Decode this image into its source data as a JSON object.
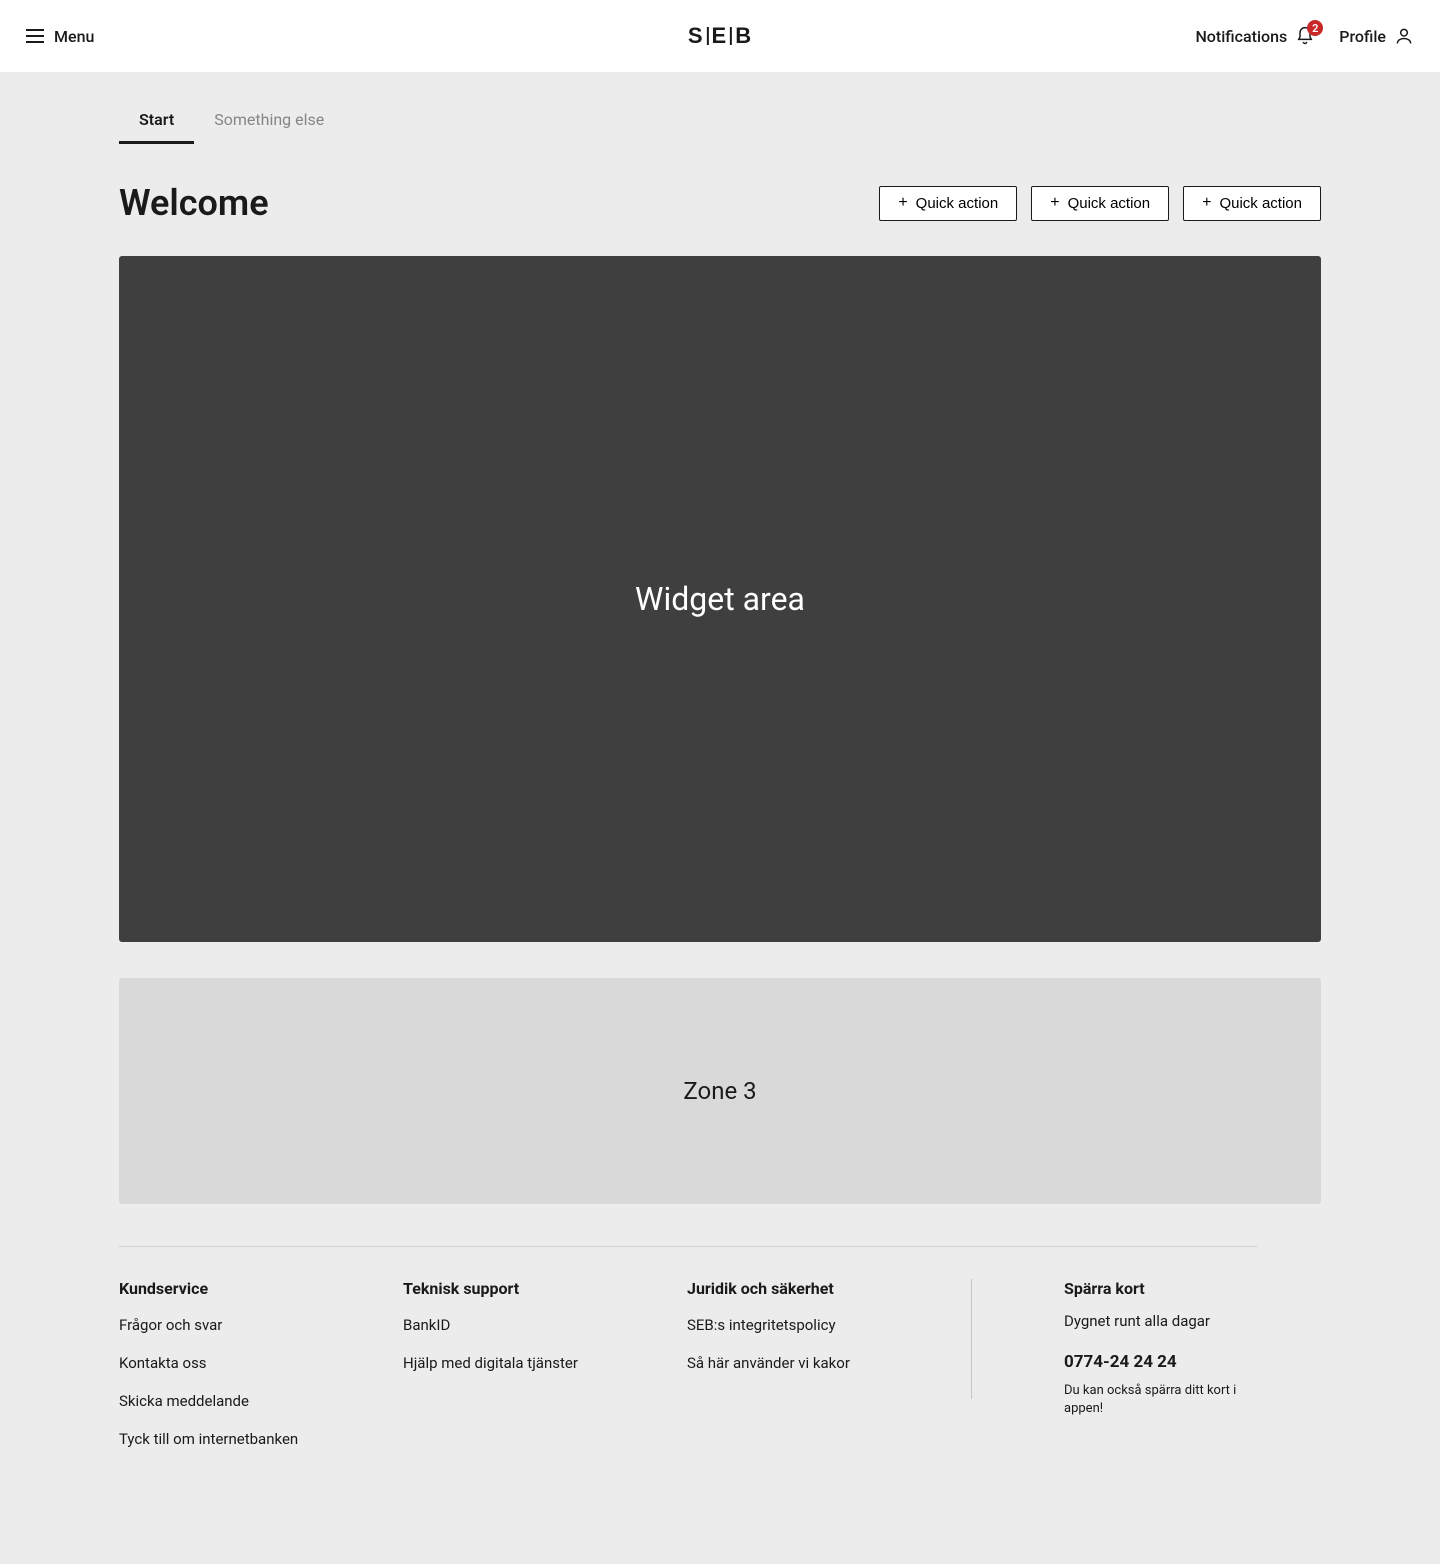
{
  "header": {
    "menu_label": "Menu",
    "logo": "SEB",
    "notifications_label": "Notifications",
    "notifications_count": "2",
    "profile_label": "Profile"
  },
  "tabs": [
    {
      "label": "Start",
      "active": true
    },
    {
      "label": "Something else",
      "active": false
    }
  ],
  "page_title": "Welcome",
  "quick_actions": [
    {
      "label": "Quick action"
    },
    {
      "label": "Quick action"
    },
    {
      "label": "Quick action"
    }
  ],
  "widget_area_label": "Widget area",
  "zone3_label": "Zone 3",
  "footer": {
    "columns": [
      {
        "heading": "Kundservice",
        "links": [
          "Frågor och svar",
          "Kontakta oss",
          "Skicka meddelande",
          "Tyck till om internetbanken"
        ]
      },
      {
        "heading": "Teknisk support",
        "links": [
          "BankID",
          "Hjälp med digitala tjänster"
        ]
      },
      {
        "heading": "Juridik och säkerhet",
        "links": [
          "SEB:s integritetspolicy",
          "Så här använder vi kakor"
        ]
      }
    ],
    "block_card": {
      "heading": "Spärra kort",
      "subtitle": "Dygnet runt alla dagar",
      "phone": "0774-24 24 24",
      "note": "Du kan också spärra ditt kort i appen!"
    }
  }
}
